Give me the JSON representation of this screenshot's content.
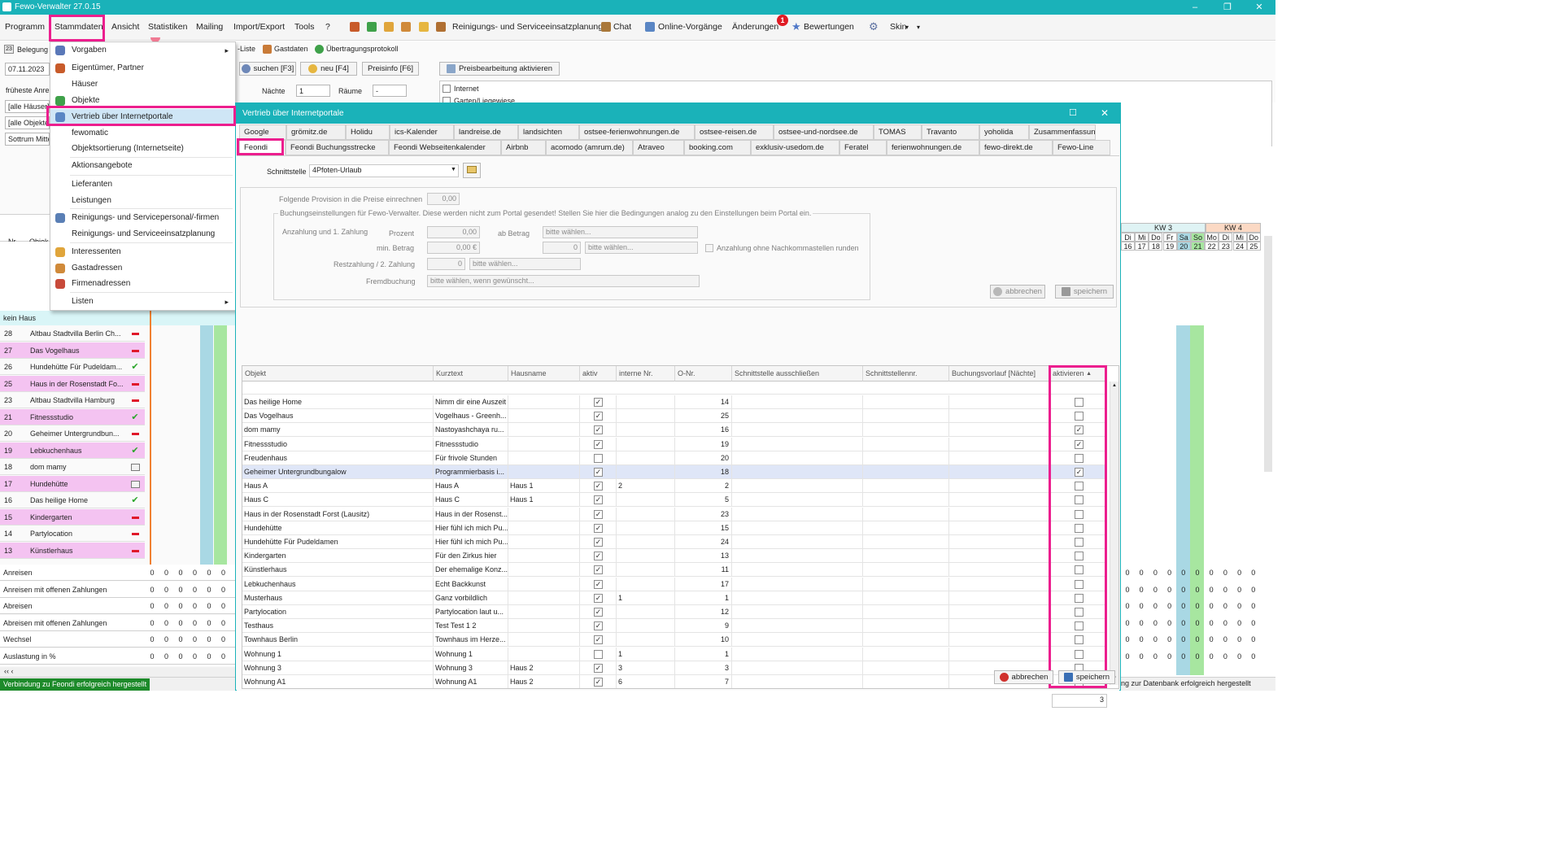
{
  "window": {
    "title": "Fewo-Verwalter 27.0.15",
    "minimize": "–",
    "restore": "❐",
    "close": "✕"
  },
  "menubar": {
    "items": [
      "Programm",
      "Stammdaten",
      "Ansicht",
      "Statistiken",
      "Mailing",
      "Import/Export",
      "Tools",
      "?"
    ],
    "reinigung": "Reinigungs- und Serviceeinsatzplanung",
    "chat": "Chat",
    "online": "Online-Vorgänge",
    "aenderungen": "Änderungen",
    "aenderungen_badge": "1",
    "bewertungen": "Bewertungen",
    "skin": "Skin",
    "skin_arrow": "▾",
    "extra_arrow": "▾"
  },
  "leftpanel": {
    "belegung_tab": "Belegung",
    "date": "07.11.2023",
    "frueheste": "früheste Anre",
    "haeuser": "[alle Häuser]",
    "objekte": "[alle Objekte",
    "sort": "Sottrum Mitte",
    "col_nr": "Nr.",
    "col_obj": "Objek",
    "group": "kein Haus",
    "rows": [
      {
        "nr": "28",
        "name": "Altbau Stadtvilla Berlin Ch...",
        "status": "red",
        "pink": false
      },
      {
        "nr": "27",
        "name": "Das Vogelhaus",
        "status": "red",
        "pink": true
      },
      {
        "nr": "26",
        "name": "Hundehütte Für Pudeldam...",
        "status": "ok",
        "pink": false
      },
      {
        "nr": "25",
        "name": "Haus in der Rosenstadt Fo...",
        "status": "red",
        "pink": true
      },
      {
        "nr": "23",
        "name": "Altbau Stadtvilla Hamburg",
        "status": "red",
        "pink": false
      },
      {
        "nr": "21",
        "name": "Fitnessstudio",
        "status": "ok",
        "pink": true
      },
      {
        "nr": "20",
        "name": "Geheimer Untergrundbun...",
        "status": "red",
        "pink": false
      },
      {
        "nr": "19",
        "name": "Lebkuchenhaus",
        "status": "ok",
        "pink": true
      },
      {
        "nr": "18",
        "name": "dom mamy",
        "status": "cal",
        "pink": false
      },
      {
        "nr": "17",
        "name": "Hundehütte",
        "status": "cal",
        "pink": true
      },
      {
        "nr": "16",
        "name": "Das heilige Home",
        "status": "ok",
        "pink": false
      },
      {
        "nr": "15",
        "name": "Kindergarten",
        "status": "red",
        "pink": true
      },
      {
        "nr": "14",
        "name": "Partylocation",
        "status": "red",
        "pink": false
      },
      {
        "nr": "13",
        "name": "Künstlerhaus",
        "status": "red",
        "pink": true
      }
    ],
    "sums": [
      "Anreisen",
      "Anreisen mit offenen Zahlungen",
      "Abreisen",
      "Abreisen mit offenen Zahlungen",
      "Wechsel",
      "Auslastung in %"
    ],
    "zero": "0"
  },
  "toolbar2": {
    "liste": "-Liste",
    "gastdaten": "Gastdaten",
    "uebertragung": "Übertragungsprotokoll",
    "suchen": "suchen [F3]",
    "neu": "neu [F4]",
    "preisinfo": "Preisinfo [F6]",
    "preisbearbeitung": "Preisbearbeitung aktivieren",
    "naechte_label": "Nächte",
    "naechte_val": "1",
    "raeume_label": "Räume",
    "raeume_val": "-",
    "internet": "Internet",
    "garten": "Garten/Liegewiese"
  },
  "dropdown": {
    "items": [
      {
        "label": "Vorgaben",
        "arrow": true
      },
      {
        "label": "Eigentümer, Partner",
        "arrow": false
      },
      {
        "label": "Häuser",
        "arrow": false
      },
      {
        "label": "Objekte",
        "arrow": false
      },
      {
        "label": "Vertrieb über Internetportale",
        "arrow": false
      },
      {
        "label": "fewomatic",
        "arrow": false
      },
      {
        "label": "Objektsortierung (Internetseite)",
        "arrow": false
      },
      {
        "label": "Aktionsangebote",
        "arrow": false
      },
      {
        "label": "Lieferanten",
        "arrow": false
      },
      {
        "label": "Leistungen",
        "arrow": false
      },
      {
        "label": "Reinigungs- und Servicepersonal/-firmen",
        "arrow": false
      },
      {
        "label": "Reinigungs- und Serviceeinsatzplanung",
        "arrow": false
      },
      {
        "label": "Interessenten",
        "arrow": false
      },
      {
        "label": "Gastadressen",
        "arrow": false
      },
      {
        "label": "Firmenadressen",
        "arrow": false
      },
      {
        "label": "Listen",
        "arrow": true
      }
    ],
    "arrow": "▸"
  },
  "dialog": {
    "title": "Vertrieb über Internetportale",
    "maximize": "☐",
    "close": "✕",
    "tabs_row1": [
      "Google",
      "grömitz.de",
      "Holidu",
      "ics-Kalender",
      "landreise.de",
      "landsichten",
      "ostsee-ferienwohnungen.de",
      "ostsee-reisen.de",
      "ostsee-und-nordsee.de",
      "TOMAS",
      "Travanto",
      "yoholida",
      "Zusammenfassung"
    ],
    "tabs_row2": [
      "Feondi",
      "Feondi Buchungsstrecke",
      "Feondi Webseitenkalender",
      "Airbnb",
      "acomodo (amrum.de)",
      "Atraveo",
      "booking.com",
      "exklusiv-usedom.de",
      "Feratel",
      "ferienwohnungen.de",
      "fewo-direkt.de",
      "Fewo-Line"
    ],
    "schnittstelle_label": "Schnittstelle",
    "schnittstelle_value": "4Pfoten-Urlaub",
    "provision_label": "Folgende Provision in die Preise einrechnen",
    "provision_value": "0,00",
    "buchung_info": "Buchungseinstellungen für Fewo-Verwalter. Diese werden nicht zum Portal gesendet! Stellen Sie hier die Bedingungen analog zu den Einstellungen beim Portal ein.",
    "anzahlung_label": "Anzahlung und 1. Zahlung",
    "prozent_label": "Prozent",
    "prozent_value": "0,00",
    "ab_betrag_label": "ab Betrag",
    "ab_betrag_value": "bitte wählen...",
    "min_betrag_label": "min. Betrag",
    "min_betrag_value": "0,00 €",
    "min_count": "0",
    "min_select": "bitte wählen...",
    "runden_label": "Anzahlung ohne Nachkommastellen runden",
    "restzahlung_label": "Restzahlung / 2. Zahlung",
    "rest_count": "0",
    "rest_select": "bitte wählen...",
    "fremd_label": "Fremdbuchung",
    "fremd_value": "bitte wählen, wenn gewünscht...",
    "abbrechen": "abbrechen",
    "speichern": "speichern",
    "grid_headers": [
      "Objekt",
      "Kurztext",
      "Hausname",
      "aktiv",
      "interne Nr.",
      "O-Nr.",
      "Schnittstelle ausschließen",
      "Schnittstellennr.",
      "Buchungsvorlauf [Nächte]",
      "aktivieren"
    ],
    "sort_arrow": "▲",
    "rows": [
      {
        "objekt": "Das heilige Home",
        "kurz": "Nimm dir eine Auszeit",
        "haus": "",
        "aktiv": true,
        "intern": "",
        "onr": "14",
        "aktivieren": false,
        "sel": false
      },
      {
        "objekt": "Das Vogelhaus",
        "kurz": "Vogelhaus - Greenh...",
        "haus": "",
        "aktiv": true,
        "intern": "",
        "onr": "25",
        "aktivieren": false,
        "sel": false
      },
      {
        "objekt": "dom mamy",
        "kurz": "Nastoyashchaya ru...",
        "haus": "",
        "aktiv": true,
        "intern": "",
        "onr": "16",
        "aktivieren": true,
        "sel": false
      },
      {
        "objekt": "Fitnessstudio",
        "kurz": "Fitnessstudio",
        "haus": "",
        "aktiv": true,
        "intern": "",
        "onr": "19",
        "aktivieren": true,
        "sel": false
      },
      {
        "objekt": "Freudenhaus",
        "kurz": "Für frivole Stunden",
        "haus": "",
        "aktiv": false,
        "intern": "",
        "onr": "20",
        "aktivieren": false,
        "sel": false
      },
      {
        "objekt": "Geheimer Untergrundbungalow",
        "kurz": "Programmierbasis i...",
        "haus": "",
        "aktiv": true,
        "intern": "",
        "onr": "18",
        "aktivieren": true,
        "sel": true
      },
      {
        "objekt": "Haus A",
        "kurz": "Haus A",
        "haus": "Haus 1",
        "aktiv": true,
        "intern": "2",
        "onr": "2",
        "aktivieren": false,
        "sel": false
      },
      {
        "objekt": "Haus C",
        "kurz": "Haus C",
        "haus": "Haus 1",
        "aktiv": true,
        "intern": "",
        "onr": "5",
        "aktivieren": false,
        "sel": false
      },
      {
        "objekt": "Haus in der Rosenstadt Forst (Lausitz)",
        "kurz": "Haus in der Rosenst...",
        "haus": "",
        "aktiv": true,
        "intern": "",
        "onr": "23",
        "aktivieren": false,
        "sel": false
      },
      {
        "objekt": "Hundehütte",
        "kurz": "Hier fühl ich mich Pu...",
        "haus": "",
        "aktiv": true,
        "intern": "",
        "onr": "15",
        "aktivieren": false,
        "sel": false
      },
      {
        "objekt": "Hundehütte Für Pudeldamen",
        "kurz": "Hier fühl ich mich Pu...",
        "haus": "",
        "aktiv": true,
        "intern": "",
        "onr": "24",
        "aktivieren": false,
        "sel": false
      },
      {
        "objekt": "Kindergarten",
        "kurz": "Für den Zirkus hier",
        "haus": "",
        "aktiv": true,
        "intern": "",
        "onr": "13",
        "aktivieren": false,
        "sel": false
      },
      {
        "objekt": "Künstlerhaus",
        "kurz": "Der ehemalige Konz...",
        "haus": "",
        "aktiv": true,
        "intern": "",
        "onr": "11",
        "aktivieren": false,
        "sel": false
      },
      {
        "objekt": "Lebkuchenhaus",
        "kurz": "Echt Backkunst",
        "haus": "",
        "aktiv": true,
        "intern": "",
        "onr": "17",
        "aktivieren": false,
        "sel": false
      },
      {
        "objekt": "Musterhaus",
        "kurz": "Ganz vorbildlich",
        "haus": "",
        "aktiv": true,
        "intern": "1",
        "onr": "1",
        "aktivieren": false,
        "sel": false
      },
      {
        "objekt": "Partylocation",
        "kurz": "Partylocation laut u...",
        "haus": "",
        "aktiv": true,
        "intern": "",
        "onr": "12",
        "aktivieren": false,
        "sel": false
      },
      {
        "objekt": "Testhaus",
        "kurz": "Test Test 1 2",
        "haus": "",
        "aktiv": true,
        "intern": "",
        "onr": "9",
        "aktivieren": false,
        "sel": false
      },
      {
        "objekt": "Townhaus Berlin",
        "kurz": "Townhaus im Herze...",
        "haus": "",
        "aktiv": true,
        "intern": "",
        "onr": "10",
        "aktivieren": false,
        "sel": false
      },
      {
        "objekt": "Wohnung 1",
        "kurz": "Wohnung 1",
        "haus": "",
        "aktiv": false,
        "intern": "1",
        "onr": "1",
        "aktivieren": false,
        "sel": false
      },
      {
        "objekt": "Wohnung 3",
        "kurz": "Wohnung 3",
        "haus": "Haus 2",
        "aktiv": true,
        "intern": "3",
        "onr": "3",
        "aktivieren": false,
        "sel": false
      },
      {
        "objekt": "Wohnung A1",
        "kurz": "Wohnung A1",
        "haus": "Haus 2",
        "aktiv": true,
        "intern": "6",
        "onr": "7",
        "aktivieren": false,
        "sel": false
      }
    ],
    "count": "3",
    "bottom_abbrechen": "abbrechen",
    "bottom_speichern": "speichern"
  },
  "calendar": {
    "kw3": "KW 3",
    "kw4": "KW 4",
    "days": [
      "Di",
      "Mi",
      "Do",
      "Fr",
      "Sa",
      "So",
      "Mo",
      "Di",
      "Mi",
      "Do"
    ],
    "dates": [
      "16",
      "17",
      "18",
      "19",
      "20",
      "21",
      "22",
      "23",
      "24",
      "25"
    ]
  },
  "statusbar": {
    "left": "Verbindung zu Feondi erfolgreich hergestellt",
    "right": "ng zur Datenbank erfolgreich hergestellt"
  },
  "colors": {
    "teal": "#1ab2b9",
    "highlight": "#ec1e8e",
    "pink_row": "#f4c3f1",
    "status_green": "#1d8a2a"
  }
}
